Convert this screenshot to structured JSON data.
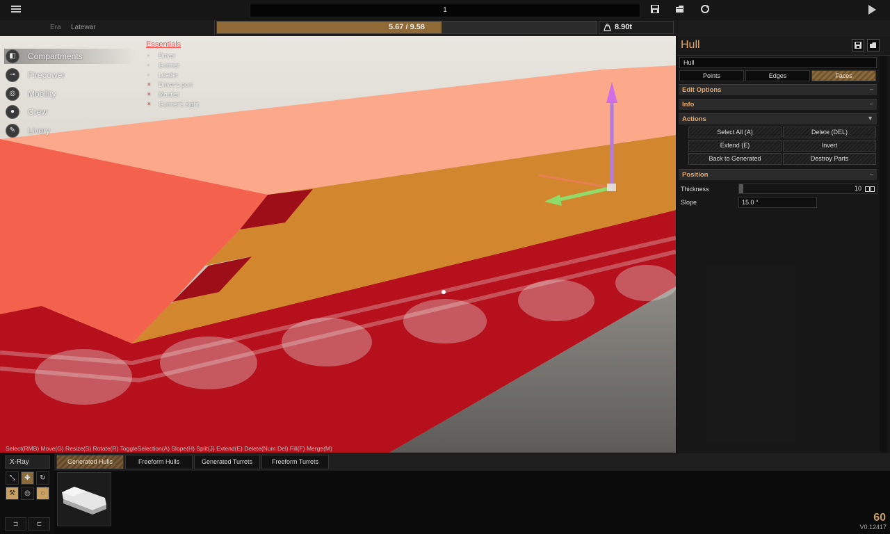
{
  "topbar": {
    "project_name": "1",
    "save_icon": "save-icon",
    "load_icon": "folder-open-icon",
    "reset_icon": "refresh-icon",
    "play_icon": "play-icon"
  },
  "erabar": {
    "era_label": "Era",
    "era_value": "Latewar",
    "cost_text": "5.67 / 9.58",
    "cost_fraction": 0.592,
    "weight_text": "8.90t",
    "weight_icon": "weight-icon"
  },
  "nav": [
    {
      "label": "Compartments",
      "icon": "cube-icon"
    },
    {
      "label": "Firepower",
      "icon": "cannon-icon"
    },
    {
      "label": "Mobility",
      "icon": "wheel-icon"
    },
    {
      "label": "Crew",
      "icon": "person-icon"
    },
    {
      "label": "Livery",
      "icon": "brush-icon"
    }
  ],
  "essentials": {
    "title": "Essentials",
    "items": [
      {
        "label": "Driver",
        "mark": "-",
        "status": "ok"
      },
      {
        "label": "Gunner",
        "mark": "-",
        "status": "ok"
      },
      {
        "label": "Loader",
        "mark": "-",
        "status": "ok"
      },
      {
        "label": "Driver's port",
        "mark": "×",
        "status": "bad"
      },
      {
        "label": "Mantlet",
        "mark": "×",
        "status": "bad"
      },
      {
        "label": "Gunner's sight",
        "mark": "×",
        "status": "bad"
      }
    ]
  },
  "hint": "Select(RMB) Move(G) Resize(S) Rotate(R) ToggleSelection(A) Slope(H) Split(J) Extend(E) Delete(Num Del) Fill(F) Merge(M)",
  "panel": {
    "title": "Hull",
    "hull_name": "Hull",
    "modes": [
      "Points",
      "Edges",
      "Faces"
    ],
    "active_mode": "Faces",
    "sections": {
      "edit_options": "Edit Options",
      "info": "Info",
      "actions": "Actions",
      "position": "Position"
    },
    "collapse_symbol": "–",
    "expand_symbol": "▼",
    "actions": [
      "Select All (A)",
      "Delete (DEL)",
      "Extend (E)",
      "Invert",
      "Back to Generated",
      "Destroy Parts"
    ],
    "thickness_label": "Thickness",
    "thickness_value": "10",
    "slope_label": "Slope",
    "slope_value": "15.0 °"
  },
  "bottom": {
    "xray_label": "X-Ray",
    "tabs": [
      "Generated Hulls",
      "Freeform Hulls",
      "Generated Turrets",
      "Freeform Turrets"
    ],
    "active_tab": "Generated Hulls",
    "tools": [
      "resize-icon",
      "move-icon",
      "rotate-icon",
      "mirror-icon",
      "snap-icon",
      "local-icon"
    ],
    "small_buttons": [
      "⊐",
      "⊏"
    ]
  },
  "fps": "60",
  "version": "V0.12417"
}
